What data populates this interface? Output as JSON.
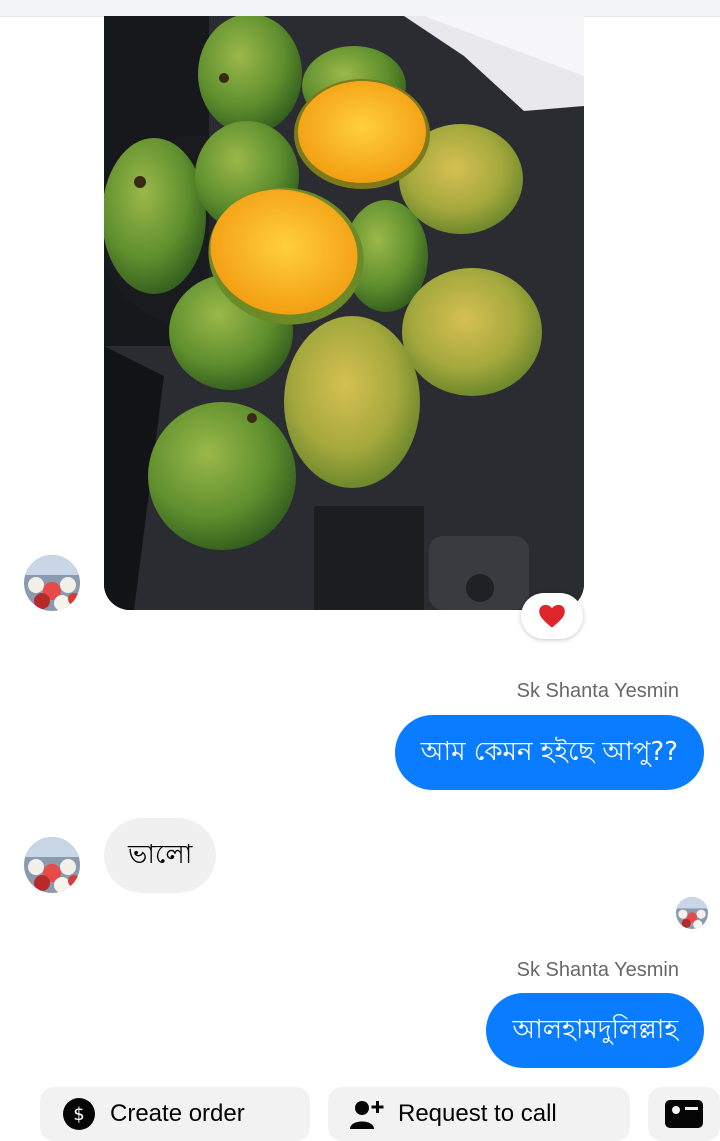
{
  "conversation": {
    "photo_message": {
      "reaction": "heart"
    },
    "messages": [
      {
        "direction": "outgoing",
        "sender": "Sk Shanta Yesmin",
        "text": "আম কেমন হইছে আপু??"
      },
      {
        "direction": "incoming",
        "text": "ভালো"
      },
      {
        "direction": "outgoing",
        "sender": "Sk Shanta Yesmin",
        "text": "আলহামদুলিল্লাহ"
      }
    ]
  },
  "quick_actions": [
    {
      "label": "Create order",
      "icon": "create-order-icon"
    },
    {
      "label": "Request to call",
      "icon": "add-person-icon"
    },
    {
      "label": "",
      "icon": "contact-card-icon"
    }
  ],
  "colors": {
    "outgoing_bubble": "#0a7cff",
    "incoming_bubble": "#f0f0f0",
    "sender_label": "#65676b",
    "reaction_heart": "#e0242b"
  }
}
